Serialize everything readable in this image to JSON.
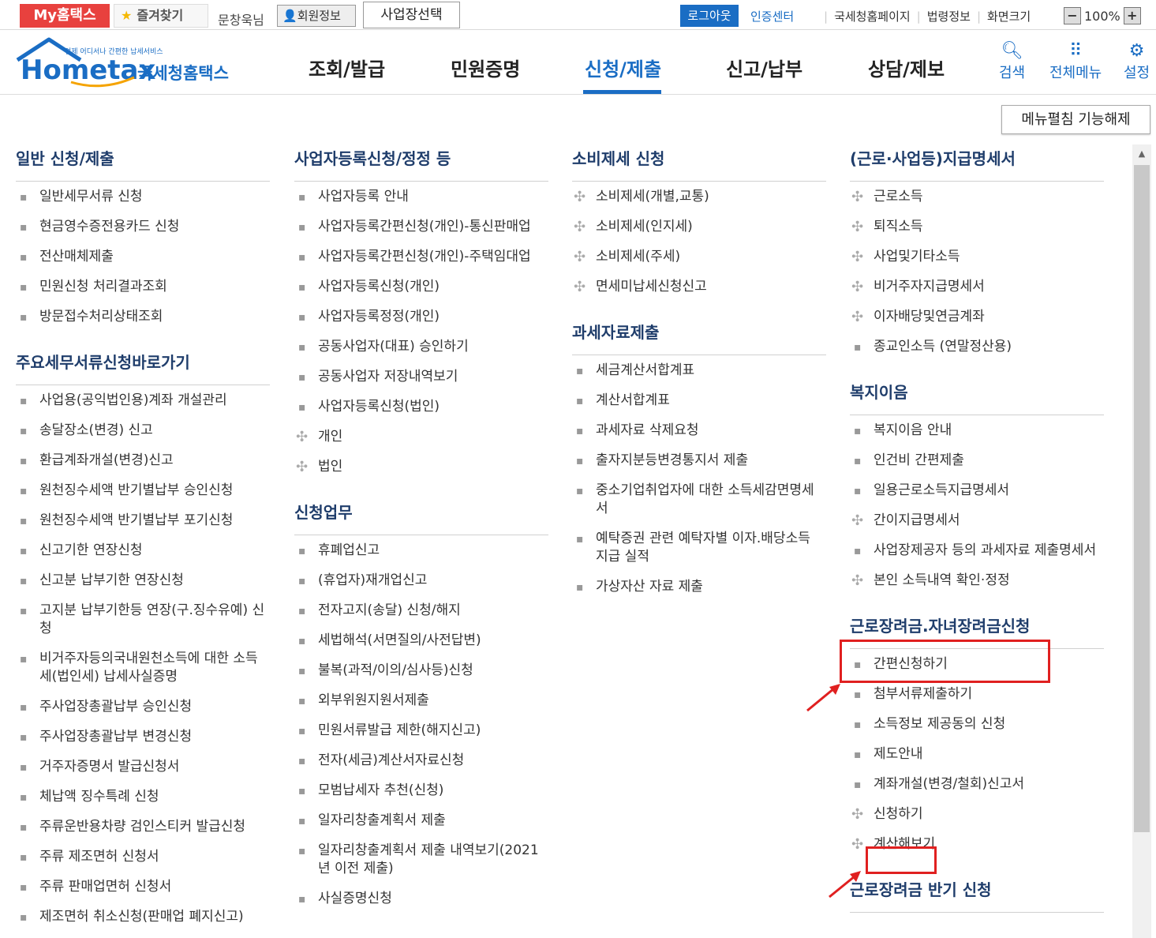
{
  "topbar": {
    "mytax": "My홈택스",
    "favorites": "즐겨찾기",
    "user": "문창욱님",
    "member_info": "회원정보",
    "biz_select": "사업장선택",
    "logout": "로그아웃",
    "cert_center": "인증센터",
    "links": [
      "국세청홈페이지",
      "법령정보",
      "화면크기"
    ],
    "zoom": "100%",
    "zoom_minus": "−",
    "zoom_plus": "+"
  },
  "header": {
    "logo_text": "Hometax",
    "logo_sub": "국세청홈택스",
    "logo_tagline": "언제 어디서나 간편한 납세서비스",
    "nav": [
      "조회/발급",
      "민원증명",
      "신청/제출",
      "신고/납부",
      "상담/제보"
    ],
    "icons": [
      "검색",
      "전체메뉴",
      "설정"
    ]
  },
  "collapse_button": "메뉴펼침 기능해제",
  "col1": [
    {
      "title": "일반 신청/제출",
      "items": [
        [
          "b",
          "일반세무서류 신청"
        ],
        [
          "b",
          "현금영수증전용카드 신청"
        ],
        [
          "b",
          "전산매체제출"
        ],
        [
          "b",
          "민원신청 처리결과조회"
        ],
        [
          "b",
          "방문접수처리상태조회"
        ]
      ]
    },
    {
      "title": "주요세무서류신청바로가기",
      "items": [
        [
          "b",
          "사업용(공익법인용)계좌 개설관리"
        ],
        [
          "b",
          "송달장소(변경) 신고"
        ],
        [
          "b",
          "환급계좌개설(변경)신고"
        ],
        [
          "b",
          "원천징수세액 반기별납부 승인신청"
        ],
        [
          "b",
          "원천징수세액 반기별납부 포기신청"
        ],
        [
          "b",
          "신고기한 연장신청"
        ],
        [
          "b",
          "신고분 납부기한 연장신청"
        ],
        [
          "b",
          "고지분 납부기한등 연장(구.징수유예) 신청"
        ],
        [
          "b",
          "비거주자등의국내원천소득에 대한 소득세(법인세) 납세사실증명"
        ],
        [
          "b",
          "주사업장총괄납부 승인신청"
        ],
        [
          "b",
          "주사업장총괄납부 변경신청"
        ],
        [
          "b",
          "거주자증명서 발급신청서"
        ],
        [
          "b",
          "체납액 징수특례 신청"
        ],
        [
          "b",
          "주류운반용차량 검인스티커 발급신청"
        ],
        [
          "b",
          "주류 제조면허 신청서"
        ],
        [
          "b",
          "주류 판매업면허 신청서"
        ],
        [
          "b",
          "제조면허 취소신청(판매업 폐지신고)"
        ]
      ]
    }
  ],
  "col2": [
    {
      "title": "사업자등록신청/정정 등",
      "items": [
        [
          "b",
          "사업자등록 안내"
        ],
        [
          "b",
          "사업자등록간편신청(개인)-통신판매업"
        ],
        [
          "b",
          "사업자등록간편신청(개인)-주택임대업"
        ],
        [
          "b",
          "사업자등록신청(개인)"
        ],
        [
          "b",
          "사업자등록정정(개인)"
        ],
        [
          "b",
          "공동사업자(대표) 승인하기"
        ],
        [
          "b",
          "공동사업자 저장내역보기"
        ],
        [
          "b",
          "사업자등록신청(법인)"
        ],
        [
          "p",
          "개인"
        ],
        [
          "p",
          "법인"
        ]
      ]
    },
    {
      "title": "신청업무",
      "items": [
        [
          "b",
          "휴폐업신고"
        ],
        [
          "b",
          "(휴업자)재개업신고"
        ],
        [
          "b",
          "전자고지(송달) 신청/해지"
        ],
        [
          "b",
          "세법해석(서면질의/사전답변)"
        ],
        [
          "b",
          "불복(과적/이의/심사등)신청"
        ],
        [
          "b",
          "외부위원지원서제출"
        ],
        [
          "b",
          "민원서류발급 제한(해지신고)"
        ],
        [
          "b",
          "전자(세금)계산서자료신청"
        ],
        [
          "b",
          "모범납세자 추천(신청)"
        ],
        [
          "b",
          "일자리창출계획서 제출"
        ],
        [
          "b",
          "일자리창출계획서 제출 내역보기(2021년 이전 제출)"
        ],
        [
          "b",
          "사실증명신청"
        ]
      ]
    }
  ],
  "col3": [
    {
      "title": "소비제세 신청",
      "items": [
        [
          "p",
          "소비제세(개별,교통)"
        ],
        [
          "p",
          "소비제세(인지세)"
        ],
        [
          "p",
          "소비제세(주세)"
        ],
        [
          "p",
          "면세미납세신청신고"
        ]
      ]
    },
    {
      "title": "과세자료제출",
      "items": [
        [
          "b",
          "세금계산서합계표"
        ],
        [
          "b",
          "계산서합계표"
        ],
        [
          "b",
          "과세자료 삭제요청"
        ],
        [
          "b",
          "출자지분등변경통지서 제출"
        ],
        [
          "b",
          "중소기업취업자에 대한 소득세감면명세서"
        ],
        [
          "b",
          "예탁증권 관련 예탁자별 이자.배당소득 지급 실적"
        ],
        [
          "b",
          "가상자산 자료 제출"
        ]
      ]
    }
  ],
  "col4": [
    {
      "title": "(근로·사업등)지급명세서",
      "items": [
        [
          "p",
          "근로소득"
        ],
        [
          "p",
          "퇴직소득"
        ],
        [
          "p",
          "사업및기타소득"
        ],
        [
          "p",
          "비거주자지급명세서"
        ],
        [
          "p",
          "이자배당및연금계좌"
        ],
        [
          "b",
          "종교인소득 (연말정산용)"
        ]
      ]
    },
    {
      "title": "복지이음",
      "items": [
        [
          "b",
          "복지이음 안내"
        ],
        [
          "b",
          "인건비 간편제출"
        ],
        [
          "b",
          "일용근로소득지급명세서"
        ],
        [
          "p",
          "간이지급명세서"
        ],
        [
          "b",
          "사업장제공자 등의 과세자료 제출명세서"
        ],
        [
          "p",
          "본인 소득내역 확인·정정"
        ]
      ]
    },
    {
      "title": "근로장려금.자녀장려금신청",
      "items": [
        [
          "b",
          "간편신청하기"
        ],
        [
          "b",
          "첨부서류제출하기"
        ],
        [
          "b",
          "소득정보 제공동의 신청"
        ],
        [
          "b",
          "제도안내"
        ],
        [
          "b",
          "계좌개설(변경/철회)신고서"
        ],
        [
          "p",
          "신청하기"
        ],
        [
          "p",
          "계산해보기"
        ]
      ]
    },
    {
      "title": "근로장려금 반기 신청",
      "items": []
    }
  ],
  "colors": {
    "accent": "#1a6dc4",
    "highlight": "#e02020",
    "brand_red": "#e8413e"
  }
}
